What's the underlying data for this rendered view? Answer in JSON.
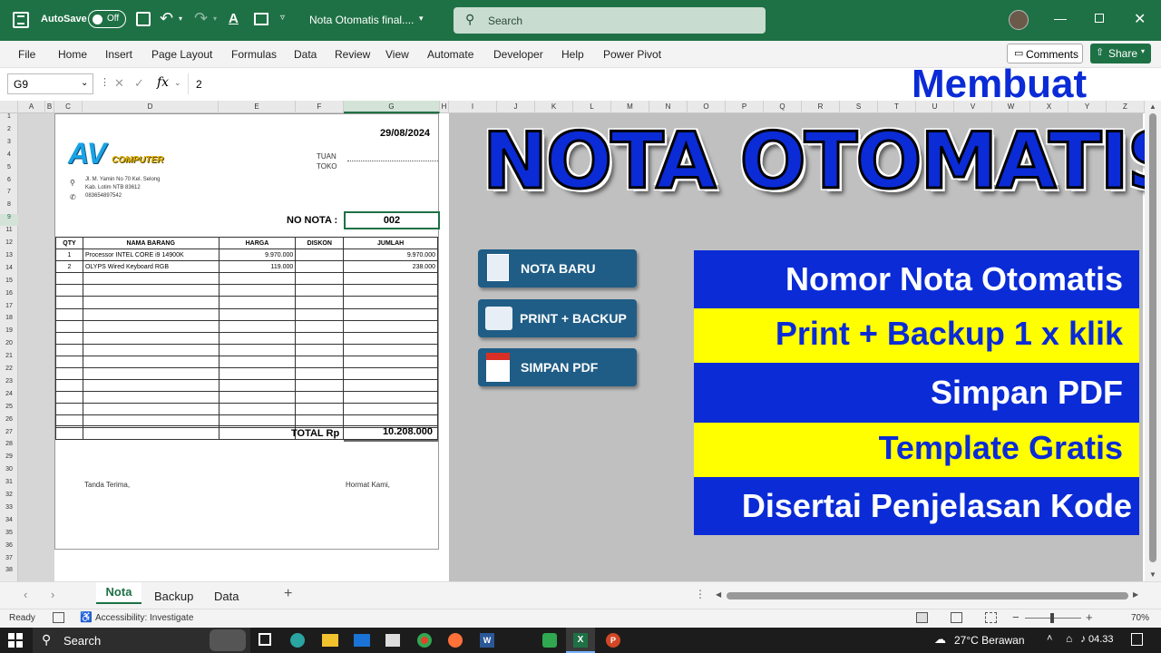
{
  "titlebar": {
    "autosave_label": "AutoSave",
    "autosave_state": "Off",
    "filename": "Nota Otomatis final....",
    "search_placeholder": "Search",
    "accent": "#1e7145"
  },
  "ribbon": {
    "tabs": [
      "File",
      "Home",
      "Insert",
      "Page Layout",
      "Formulas",
      "Data",
      "Review",
      "View",
      "Automate",
      "Developer",
      "Help",
      "Power Pivot"
    ],
    "comments_label": "Comments",
    "share_label": "Share"
  },
  "formula_bar": {
    "cell_ref": "G9",
    "fx_label": "fx",
    "value": "2"
  },
  "columns": [
    "A",
    "B",
    "C",
    "D",
    "E",
    "F",
    "G",
    "H",
    "I",
    "J",
    "K",
    "L",
    "M",
    "N",
    "O",
    "P",
    "Q",
    "R",
    "S",
    "T",
    "U",
    "V",
    "W",
    "X",
    "Y",
    "Z"
  ],
  "rows": [
    "1",
    "2",
    "3",
    "4",
    "5",
    "6",
    "7",
    "8",
    "9",
    "11",
    "12",
    "13",
    "14",
    "15",
    "16",
    "17",
    "18",
    "19",
    "20",
    "21",
    "22",
    "23",
    "24",
    "25",
    "26",
    "27",
    "28",
    "29",
    "30",
    "31",
    "32",
    "33",
    "34",
    "35",
    "36",
    "37",
    "38"
  ],
  "invoice": {
    "date": "29/08/2024",
    "logo_big": "AV",
    "logo_small": "COMPUTER",
    "address_line1": "Jl. M. Yamin No 70 Kel. Selong",
    "address_line2": "Kab. Lotim NTB 83612",
    "phone": "083654897542",
    "tuan_label": "TUAN",
    "toko_label": "TOKO",
    "no_nota_label": "NO NOTA :",
    "no_nota_value": "002",
    "headers": [
      "QTY",
      "NAMA BARANG",
      "HARGA",
      "DISKON",
      "JUMLAH"
    ],
    "items": [
      {
        "qty": "1",
        "name": "Processor INTEL CORE i9 14900K",
        "price": "9.970.000",
        "disc": "",
        "total": "9.970.000"
      },
      {
        "qty": "2",
        "name": "OLYPS Wired Keyboard RGB",
        "price": "119.000",
        "disc": "",
        "total": "238.000"
      }
    ],
    "total_label": "TOTAL Rp",
    "total_value": "10.208.000",
    "sign_left": "Tanda Terima,",
    "sign_right": "Hormat Kami,"
  },
  "macros": {
    "nota_baru": "NOTA BARU",
    "print_backup": "PRINT + BACKUP",
    "simpan_pdf": "SIMPAN PDF"
  },
  "overlay": {
    "membuat": "Membuat",
    "headline": "NOTA OTOMATIS",
    "bands": [
      {
        "text": "Nomor Nota Otomatis",
        "bg": "#0a2bd6",
        "fg": "#ffffff"
      },
      {
        "text": "Print + Backup 1 x klik",
        "bg": "#ffff00",
        "fg": "#0a2bd6"
      },
      {
        "text": "Simpan PDF",
        "bg": "#0a2bd6",
        "fg": "#ffffff"
      },
      {
        "text": "Template Gratis",
        "bg": "#ffff00",
        "fg": "#0a2bd6"
      },
      {
        "text": "Disertai Penjelasan Kode",
        "bg": "#0a2bd6",
        "fg": "#ffffff"
      }
    ]
  },
  "sheet_tabs": [
    "Nota",
    "Backup",
    "Data"
  ],
  "status": {
    "ready": "Ready",
    "accessibility": "Accessibility: Investigate",
    "zoom": "70%"
  },
  "taskbar": {
    "search_label": "Search",
    "weather": "27°C Berawan",
    "time": "04.33"
  }
}
